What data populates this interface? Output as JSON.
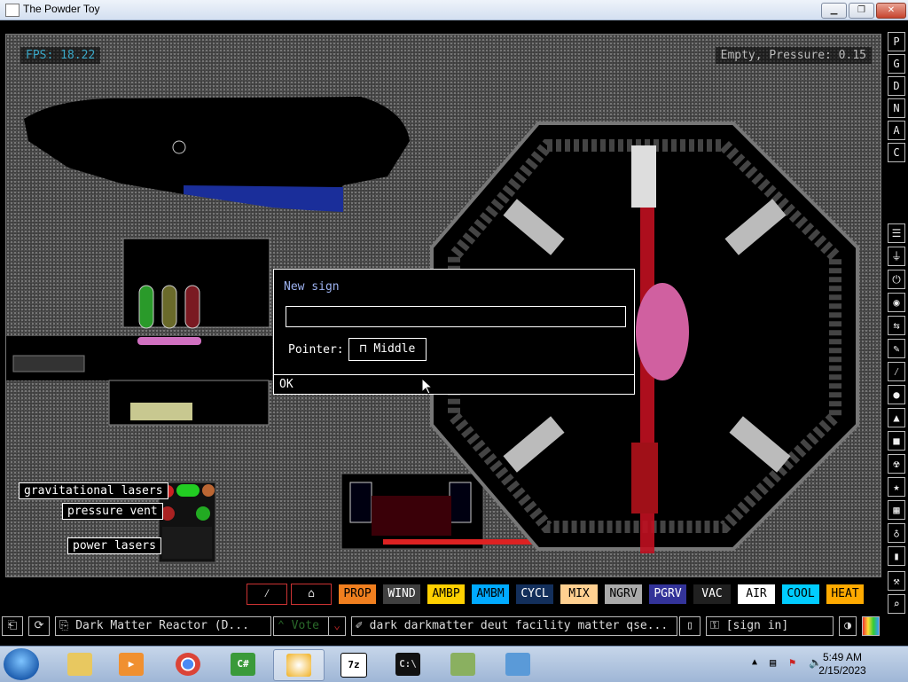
{
  "window": {
    "title": "The Powder Toy",
    "min_icon": "minimize-icon",
    "max_icon": "maximize-icon",
    "close_icon": "close-icon"
  },
  "hud": {
    "fps": "FPS: 18.22",
    "pressure": "Empty, Pressure: 0.15"
  },
  "sim_labels": {
    "grav": "gravitational lasers",
    "vent": "pressure vent",
    "power": "power lasers"
  },
  "right_bar": {
    "top": [
      "P",
      "G",
      "D",
      "N",
      "A",
      "C"
    ],
    "icons": [
      "menu-icon",
      "plug-icon",
      "power-icon",
      "sensor-icon",
      "arrows-icon",
      "brush-icon",
      "drop-icon",
      "powder-icon",
      "square-icon",
      "radiation-icon",
      "star-icon",
      "life-icon",
      "bulb-icon",
      "bookmark-icon",
      "tool-icon",
      "search-icon"
    ]
  },
  "elements": [
    {
      "label": "",
      "bg": "#000000",
      "fg": "#ffffff",
      "icon": "wand-icon"
    },
    {
      "label": "",
      "bg": "#000000",
      "fg": "#ffffff",
      "icon": "sign-icon"
    },
    {
      "label": "PROP",
      "bg": "#f07f1f",
      "fg": "#000000"
    },
    {
      "label": "WIND",
      "bg": "#404040",
      "fg": "#ffffff"
    },
    {
      "label": "AMBP",
      "bg": "#ffd000",
      "fg": "#000000"
    },
    {
      "label": "AMBM",
      "bg": "#00aaff",
      "fg": "#000000"
    },
    {
      "label": "CYCL",
      "bg": "#132f5b",
      "fg": "#ffffff"
    },
    {
      "label": "MIX",
      "bg": "#ffd090",
      "fg": "#000000"
    },
    {
      "label": "NGRV",
      "bg": "#aaaaaa",
      "fg": "#000000"
    },
    {
      "label": "PGRV",
      "bg": "#333399",
      "fg": "#ffffff"
    },
    {
      "label": "VAC",
      "bg": "#202020",
      "fg": "#ffffff"
    },
    {
      "label": "AIR",
      "bg": "#ffffff",
      "fg": "#000000"
    },
    {
      "label": "COOL",
      "bg": "#00ccff",
      "fg": "#000000"
    },
    {
      "label": "HEAT",
      "bg": "#ffaa00",
      "fg": "#000000"
    }
  ],
  "bottom_bar": {
    "open_icon": "open-icon",
    "reload_icon": "reload-icon",
    "save_name": "Dark Matter Reactor (D...",
    "vote": "Vote",
    "tags": "dark darkmatter deut facility matter qse...",
    "login": "[sign in]",
    "render_icon": "render-icon",
    "pause_icon": "pause-icon"
  },
  "dialog": {
    "title": "New sign",
    "value": "",
    "pointer_label": "Pointer:",
    "pointer_value": "Middle",
    "ok": "OK"
  },
  "taskbar": {
    "apps": [
      "explorer",
      "media",
      "chrome",
      "csharp",
      "powder-toy",
      "7zip",
      "cmd",
      "network",
      "control-panel"
    ],
    "time": "5:49 AM",
    "date": "2/15/2023"
  }
}
